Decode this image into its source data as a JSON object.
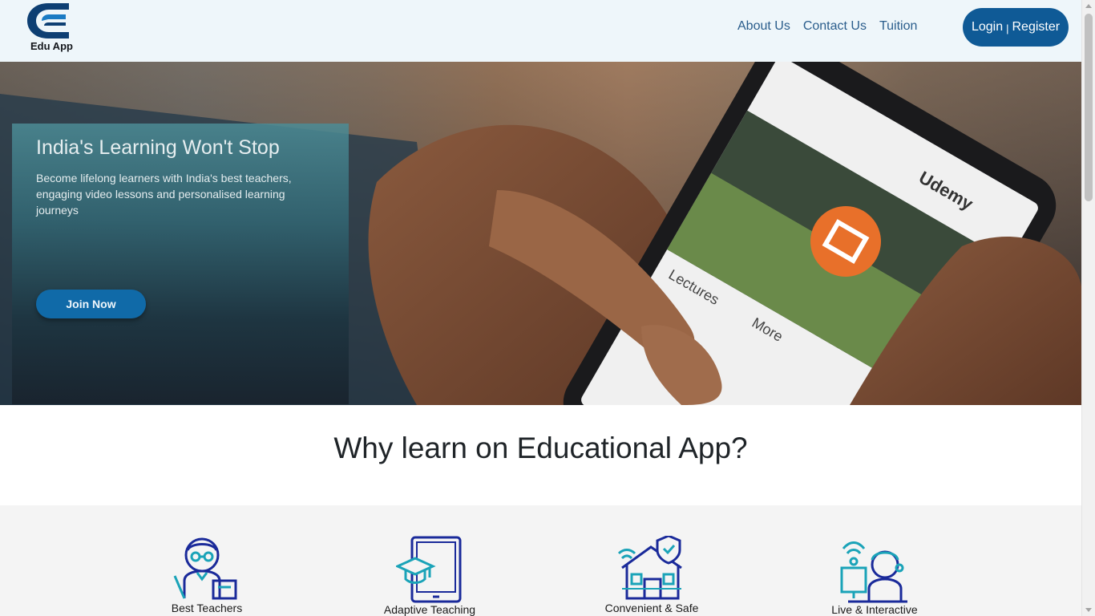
{
  "header": {
    "logo_text": "Edu App",
    "nav": [
      {
        "label": "About Us"
      },
      {
        "label": "Contact Us"
      },
      {
        "label": "Tuition"
      }
    ],
    "login_label": "Login",
    "login_sep": "|",
    "register_label": "Register"
  },
  "hero": {
    "title": "India's Learning Won't Stop",
    "subtitle": "Become lifelong learners with India's best teachers, engaging video lessons and personalised learning journeys",
    "cta_label": "Join Now",
    "phone_app_name": "Udemy",
    "phone_tabs": [
      "Lectures",
      "More"
    ]
  },
  "why": {
    "title": "Why learn on Educational App?",
    "features": [
      {
        "label": "Best Teachers",
        "icon": "teacher-icon"
      },
      {
        "label": "Adaptive Teaching",
        "icon": "tablet-graduation-icon"
      },
      {
        "label": "Convenient & Safe",
        "icon": "safe-home-icon"
      },
      {
        "label": "Live & Interactive",
        "icon": "live-interactive-icon"
      }
    ]
  },
  "colors": {
    "header_bg": "#eef6fa",
    "nav_link": "#2a5d8c",
    "primary_button": "#0f5a96",
    "hero_card": "#326976",
    "features_bg": "#f4f4f4"
  }
}
